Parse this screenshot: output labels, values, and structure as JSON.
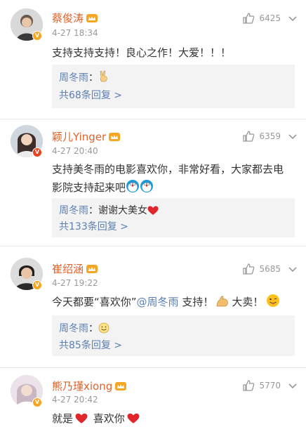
{
  "comments": [
    {
      "name": "蔡俊涛",
      "time": "4-27 18:34",
      "likes": "6425",
      "text": "支持支持支持！良心之作！大爱！！！",
      "reply": {
        "name": "周冬雨",
        "sep": "：",
        "text": "",
        "emoji": "victory-hand"
      },
      "more": "共68条回复 >"
    },
    {
      "name": "颖儿Yinger",
      "time": "4-27 20:40",
      "likes": "6359",
      "text_line1": "支持美冬雨的电影喜欢你，非常好看，大家都去电",
      "text_line2": "影院支持起来吧",
      "reply": {
        "name": "周冬雨",
        "sep": "：",
        "text": "谢谢大美女",
        "emoji": "red-heart"
      },
      "more": "共133条回复 >"
    },
    {
      "name": "崔绍涵",
      "time": "4-27 19:22",
      "likes": "5685",
      "text_before": "今天都要“喜欢你”",
      "mention": "@周冬雨",
      "text_after": " 支持！",
      "text_tail": "大卖！",
      "reply": {
        "name": "周冬雨",
        "sep": "：",
        "text": "",
        "emoji": "smile"
      },
      "more": "共85条回复 >"
    },
    {
      "name": "熊乃瑾xiong",
      "time": "4-27 20:42",
      "likes": "5770",
      "text_before": "就是",
      "text_after": " 喜欢你"
    }
  ],
  "colors": {
    "name": "#e0622a",
    "link": "#5b7fb2",
    "meta": "#999999",
    "reply_bg": "#f3f3f3",
    "vip": "#f5a623",
    "heart": "#e0262b"
  }
}
